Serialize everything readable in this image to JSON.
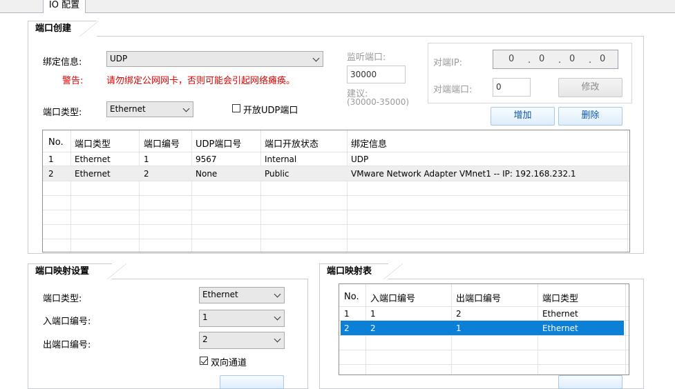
{
  "top_tab": {
    "label": "IO 配置"
  },
  "port_creation": {
    "title": "端口创建",
    "bind_label": "绑定信息:",
    "bind_value": "UDP",
    "warning_label": "警告:",
    "warning_text": "请勿绑定公网网卡，否则可能会引起网络瘫痪。",
    "port_type_label": "端口类型:",
    "port_type_value": "Ethernet",
    "open_udp_label": "开放UDP端口",
    "listen_port_label": "监听端口:",
    "listen_port_value": "30000",
    "suggest_label": "建议:",
    "suggest_range": "(30000-35000)",
    "peer_ip_label": "对端IP:",
    "peer_ip_octets": [
      "0",
      "0",
      "0",
      "0"
    ],
    "peer_port_label": "对端端口:",
    "peer_port_value": "0",
    "modify_button": "修改",
    "add_button": "增加",
    "delete_button": "删除",
    "table": {
      "headers": [
        "No.",
        "端口类型",
        "端口编号",
        "UDP端口号",
        "端口开放状态",
        "绑定信息"
      ],
      "rows": [
        [
          "1",
          "Ethernet",
          "1",
          "9567",
          "Internal",
          "UDP"
        ],
        [
          "2",
          "Ethernet",
          "2",
          "None",
          "Public",
          "VMware Network Adapter VMnet1 -- IP: 192.168.232.1"
        ]
      ]
    }
  },
  "mapping_settings": {
    "title": "端口映射设置",
    "port_type_label": "端口类型:",
    "port_type_value": "Ethernet",
    "in_port_label": "入端口编号:",
    "in_port_value": "1",
    "out_port_label": "出端口编号:",
    "out_port_value": "2",
    "bidirectional_label": "双向通道"
  },
  "mapping_table": {
    "title": "端口映射表",
    "headers": [
      "No.",
      "入端口编号",
      "出端口编号",
      "端口类型"
    ],
    "rows": [
      [
        "1",
        "1",
        "2",
        "Ethernet"
      ],
      [
        "2",
        "2",
        "1",
        "Ethernet"
      ]
    ]
  }
}
